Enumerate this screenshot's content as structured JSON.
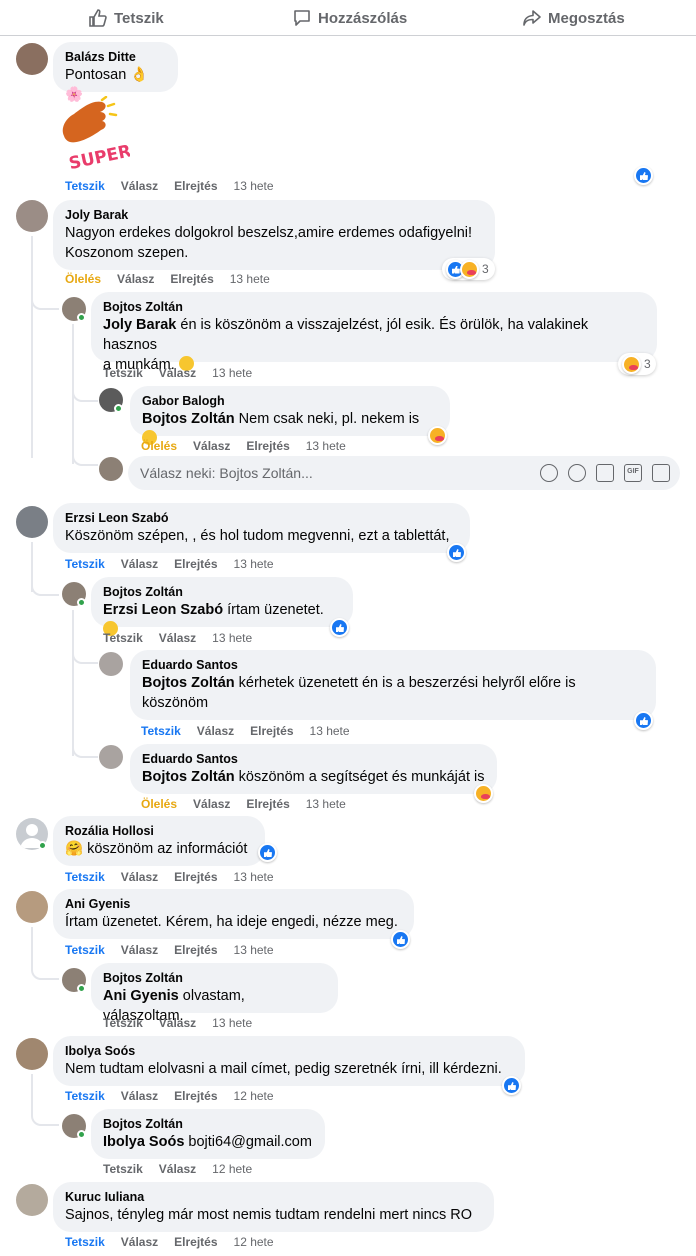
{
  "actions": {
    "like": "Tetszik",
    "comment": "Hozzászólás",
    "share": "Megosztás"
  },
  "labels": {
    "like": "Tetszik",
    "reply": "Válasz",
    "hide": "Elrejtés",
    "hug": "Ölelés"
  },
  "sticker_text": "SUPER!",
  "c1": {
    "name": "Balázs Ditte",
    "text": "Pontosan",
    "time": "13 hete"
  },
  "c2": {
    "name": "Joly Barak",
    "text1": "Nagyon erdekes dolgokrol beszelsz,amire erdemes odafigyelni!",
    "text2": "Koszonom szepen.",
    "time": "13 hete",
    "reactions": "3"
  },
  "c2r1": {
    "name": "Bojtos Zoltán",
    "mention": "Joly Barak",
    "text1": " én is köszönöm a visszajelzést, jól esik. És örülök, ha valakinek hasznos",
    "text2": "a munkám.",
    "time": "13 hete",
    "reactions": "3"
  },
  "c2r2": {
    "name": "Gabor Balogh",
    "mention": "Bojtos Zoltán",
    "text": " Nem csak neki, pl. nekem is",
    "time": "13 hete"
  },
  "reply_input": {
    "placeholder": "Válasz neki: Bojtos Zoltán..."
  },
  "c3": {
    "name": "Erzsi Leon Szabó",
    "text": "Köszönöm szépen, , és hol tudom megvenni, ezt a tablettát,",
    "time": "13 hete"
  },
  "c3r1": {
    "name": "Bojtos Zoltán",
    "mention": "Erzsi Leon Szabó",
    "text": " írtam üzenetet.",
    "time": "13 hete"
  },
  "c3r2": {
    "name": "Eduardo Santos",
    "mention": "Bojtos Zoltán",
    "text1": " kérhetek üzenetett én is a beszerzési helyről előre is",
    "text2": "köszönöm",
    "time": "13 hete"
  },
  "c3r3": {
    "name": "Eduardo Santos",
    "mention": "Bojtos Zoltán",
    "text": " köszönöm a segítséget és munkáját is",
    "time": "13 hete"
  },
  "c4": {
    "name": "Rozália Hollosi",
    "text": "köszönöm az információt",
    "time": "13 hete"
  },
  "c5": {
    "name": "Ani Gyenis",
    "text": "Írtam üzenetet. Kérem, ha ideje engedi, nézze meg.",
    "time": "13 hete"
  },
  "c5r1": {
    "name": "Bojtos Zoltán",
    "mention": "Ani Gyenis",
    "text": " olvastam, válaszoltam.",
    "time": "13 hete"
  },
  "c6": {
    "name": "Ibolya Soós",
    "text": "Nem tudtam elolvasni a mail címet, pedig szeretnék írni, ill kérdezni.",
    "time": "12 hete"
  },
  "c6r1": {
    "name": "Bojtos Zoltán",
    "mention": "Ibolya Soós",
    "text": " bojti64@gmail.com",
    "time": "12 hete"
  },
  "c7": {
    "name": "Kuruc Iuliana",
    "text": "Sajnos, tényleg már most nemis tudtam rendelni mert nincs RO",
    "time": "12 hete"
  },
  "colors": {
    "blue": "#1877f2",
    "gray": "#65676b",
    "bubble": "#f0f2f5",
    "gold": "#e7a812"
  }
}
